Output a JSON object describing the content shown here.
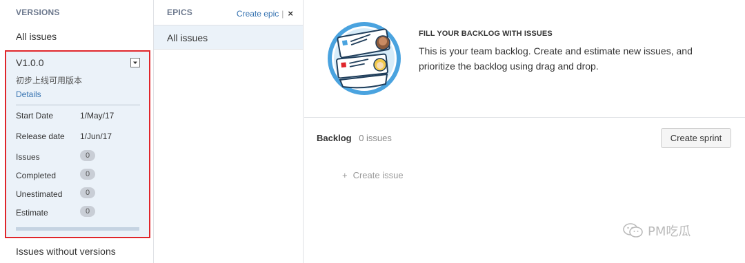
{
  "versions": {
    "header": "VERSIONS",
    "all_issues": "All issues",
    "card": {
      "name": "V1.0.0",
      "description": "初步上线可用版本",
      "details_link": "Details",
      "start_date_label": "Start Date",
      "start_date": "1/May/17",
      "release_date_label": "Release date",
      "release_date": "1/Jun/17",
      "stats": [
        {
          "label": "Issues",
          "value": "0"
        },
        {
          "label": "Completed",
          "value": "0"
        },
        {
          "label": "Unestimated",
          "value": "0"
        },
        {
          "label": "Estimate",
          "value": "0"
        }
      ],
      "progress_fraction": 0
    },
    "without_versions": "Issues without versions"
  },
  "epics": {
    "header": "EPICS",
    "create_link": "Create epic",
    "separator": "|",
    "close_glyph": "×",
    "all_issues": "All issues"
  },
  "banner": {
    "title": "FILL YOUR BACKLOG WITH ISSUES",
    "body": "This is your team backlog. Create and estimate new issues, and prioritize the backlog using drag and drop."
  },
  "backlog": {
    "title": "Backlog",
    "count": "0 issues",
    "create_sprint": "Create sprint",
    "create_issue_plus": "+",
    "create_issue": "Create issue"
  },
  "watermark": {
    "text": "PM吃瓜",
    "icon": "wechat-icon"
  },
  "colors": {
    "highlight_border": "#e0262b",
    "selected_bg": "#ebf2f9",
    "link": "#3572b0",
    "illustration_circle": "#4aa3df"
  }
}
